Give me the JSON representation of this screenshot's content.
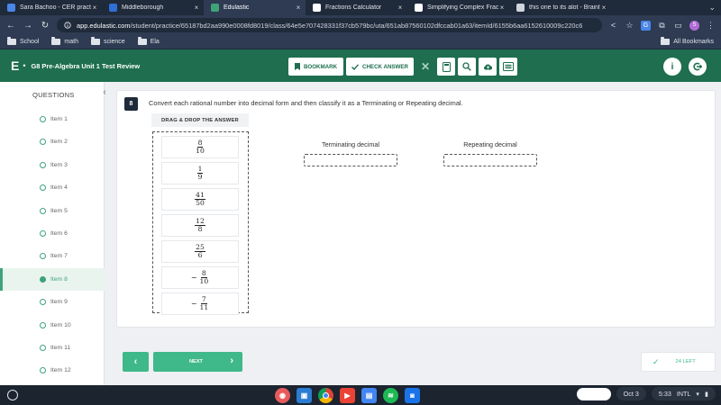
{
  "browser": {
    "tabs": [
      {
        "title": "Sara Bachoo - CER practice",
        "color": "#4a86e8",
        "active": false
      },
      {
        "title": "Middleborough",
        "color": "#2f6fd6",
        "active": false
      },
      {
        "title": "Edulastic",
        "color": "#3fa37a",
        "active": true
      },
      {
        "title": "Fractions Calculator",
        "color": "#ffffff",
        "active": false
      },
      {
        "title": "Simplifying Complex Fracti",
        "color": "#ffffff",
        "active": false
      },
      {
        "title": "this one to its alot - Brainly",
        "color": "#cfd5de",
        "active": false
      }
    ],
    "close_glyph": "×",
    "url_host": "app.edulastic.com",
    "url_path": "/student/practice/65187bd2aa990e0008fd8019/class/64e5e707428331f37cb579bc/uta/651ab87560102dfccab01a63/itemId/6155b6aa6152610009c220c6",
    "bookmarks": [
      "School",
      "math",
      "science",
      "Ela"
    ],
    "all_bookmarks": "All Bookmarks"
  },
  "header": {
    "logo": "E",
    "title": "G8 Pre-Algebra Unit 1 Test Review",
    "bookmark_label": "BOOKMARK",
    "check_answer_label": "CHECK ANSWER"
  },
  "sidebar": {
    "title": "QUESTIONS",
    "items": [
      {
        "label": "Item 1",
        "active": false
      },
      {
        "label": "Item 2",
        "active": false
      },
      {
        "label": "Item 3",
        "active": false
      },
      {
        "label": "Item 4",
        "active": false
      },
      {
        "label": "Item 5",
        "active": false
      },
      {
        "label": "Item 6",
        "active": false
      },
      {
        "label": "Item 7",
        "active": false
      },
      {
        "label": "Item 8",
        "active": true
      },
      {
        "label": "Item 9",
        "active": false
      },
      {
        "label": "Item 10",
        "active": false
      },
      {
        "label": "Item 11",
        "active": false
      },
      {
        "label": "Item 12",
        "active": false
      }
    ]
  },
  "question": {
    "number": "8",
    "text": "Convert each rational number into decimal form and then classify it as a Terminating or Repeating decimal.",
    "drag_label": "DRAG & DROP THE ANSWER",
    "choices": [
      {
        "sign": "",
        "numerator": "8",
        "denominator": "10"
      },
      {
        "sign": "",
        "numerator": "1",
        "denominator": "9"
      },
      {
        "sign": "",
        "numerator": "41",
        "denominator": "50"
      },
      {
        "sign": "",
        "numerator": "12",
        "denominator": "8"
      },
      {
        "sign": "",
        "numerator": "25",
        "denominator": "6"
      },
      {
        "sign": "−",
        "numerator": "8",
        "denominator": "10"
      },
      {
        "sign": "−",
        "numerator": "7",
        "denominator": "11"
      }
    ],
    "column_terminating": "Terminating decimal",
    "column_repeating": "Repeating decimal"
  },
  "footer": {
    "next_label": "NEXT",
    "left_count": "24 LEFT"
  },
  "shelf": {
    "date": "Oct 3",
    "time": "5:33",
    "locale": "INTL"
  },
  "colors": {
    "brand_green": "#1e6e4f",
    "accent_green": "#3fb88a"
  }
}
